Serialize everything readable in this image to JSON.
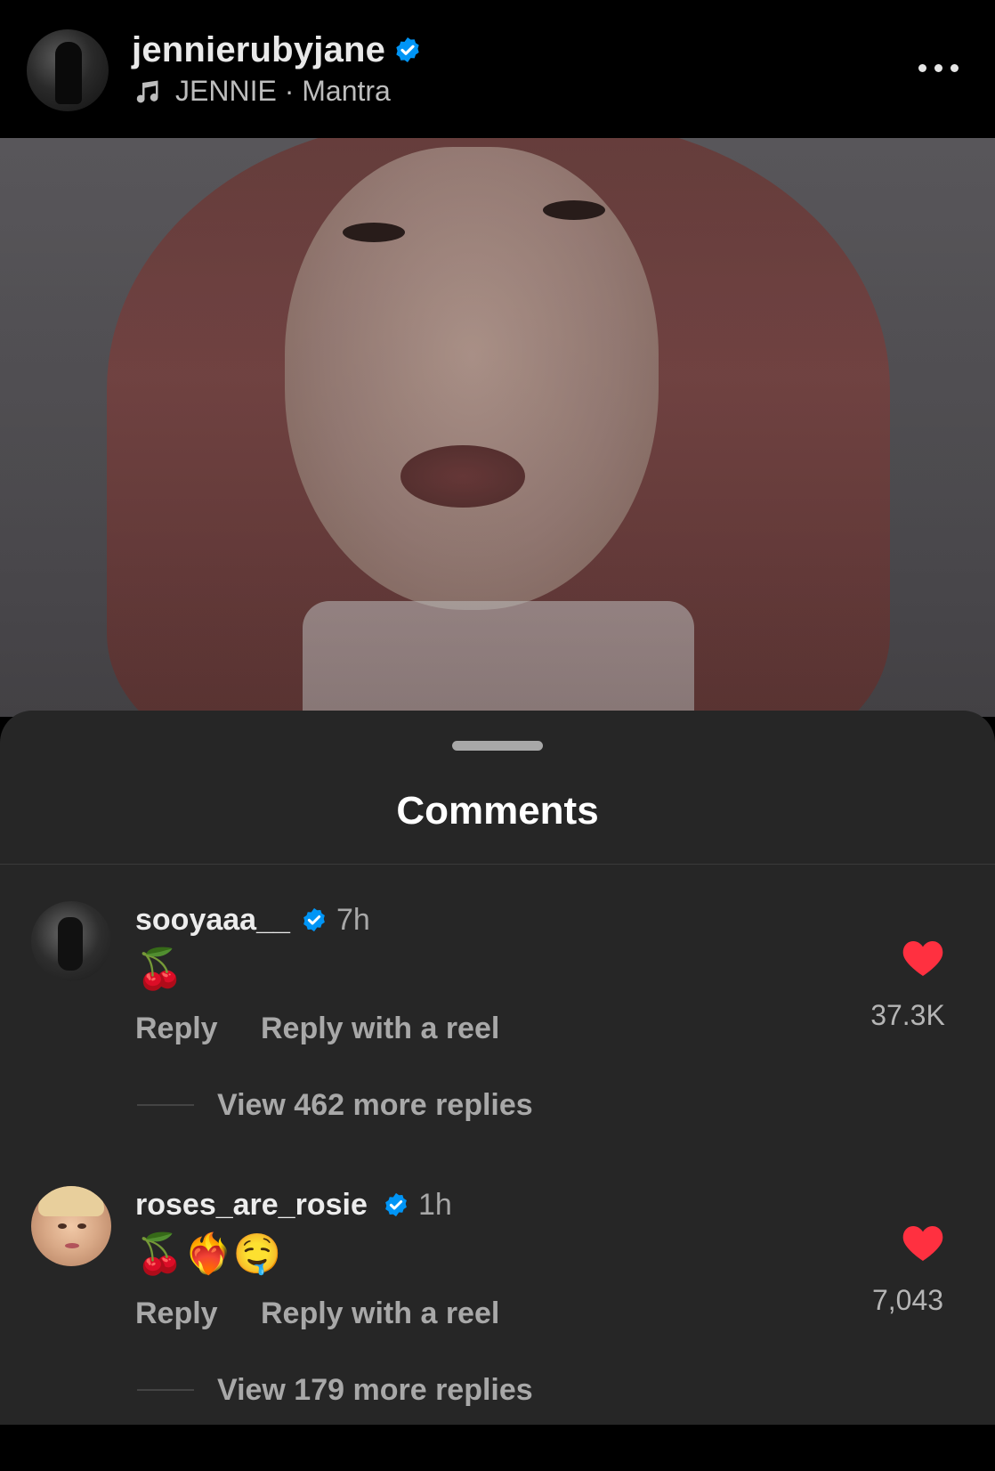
{
  "header": {
    "username": "jennierubyjane",
    "music": "JENNIE · Mantra"
  },
  "sheet": {
    "title": "Comments"
  },
  "comments": [
    {
      "username": "sooyaaa__",
      "time": "7h",
      "text": "🍒",
      "reply_label": "Reply",
      "reel_label": "Reply with a reel",
      "likes": "37.3K",
      "more_replies": "View 462 more replies"
    },
    {
      "username": "roses_are_rosie",
      "time": "1h",
      "text": "🍒❤️‍🔥🤤",
      "reply_label": "Reply",
      "reel_label": "Reply with a reel",
      "likes": "7,043",
      "more_replies": "View 179 more replies"
    }
  ],
  "colors": {
    "verified": "#0095f6",
    "like_heart": "#ff3040",
    "sheet_bg": "#262626"
  },
  "icons": [
    "avatar",
    "verified-badge-icon",
    "music-note-icon",
    "more-options-icon",
    "heart-icon"
  ]
}
